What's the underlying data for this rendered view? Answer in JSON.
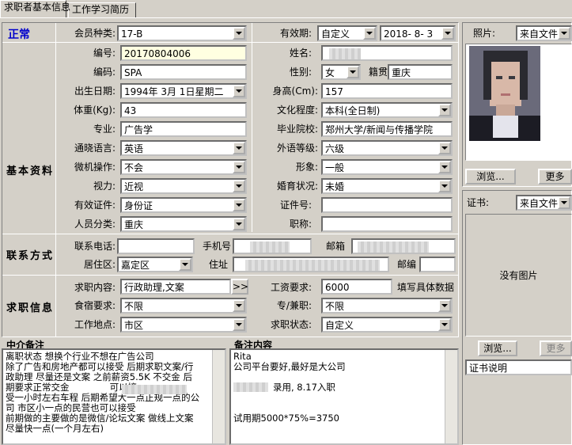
{
  "tabs": [
    {
      "label": "求职者基本信息"
    },
    {
      "label": "工作学习简历"
    }
  ],
  "status": "正常",
  "sections": {
    "basic": "基本资料",
    "contact": "联系方式",
    "job": "求职信息",
    "agent_note": "中介备注",
    "remark": "备注内容"
  },
  "labels": {
    "member_type": "会员种类:",
    "validity": "有效期:",
    "number": "编号:",
    "name": "姓名:",
    "code": "编码:",
    "gender": "性别:",
    "native": "籍贯",
    "birth": "出生日期:",
    "height": "身高(Cm):",
    "weight": "体重(Kg):",
    "education": "文化程度:",
    "major": "专业:",
    "school": "毕业院校:",
    "language": "通晓语言:",
    "foreign": "外语等级:",
    "computer": "微机操作:",
    "appearance": "形象:",
    "eyesight": "视力:",
    "marital": "婚育状况:",
    "id_type": "有效证件:",
    "id_no": "证件号:",
    "category": "人员分类:",
    "title": "职称:",
    "phone": "联系电话:",
    "mobile": "手机号",
    "email": "邮箱",
    "residence": "居住区:",
    "address": "住址",
    "postcode": "邮编",
    "job_content": "求职内容:",
    "salary": "工资要求:",
    "salary_note": "填写具体数据",
    "board": "食宿要求:",
    "fulltime": "专/兼职:",
    "location": "工作地点:",
    "job_status": "求职状态:",
    "photo": "照片:",
    "cert": "证书:"
  },
  "values": {
    "member_type": "17-B",
    "validity_type": "自定义",
    "validity_date": "2018- 8- 3",
    "number": "20170804006",
    "code": "SPA",
    "gender": "女",
    "native": "重庆",
    "birth": "1994年 3月 1日星期二",
    "height": "157",
    "weight": "43",
    "education": "本科(全日制)",
    "major": "广告学",
    "school": "郑州大学/新闻与传播学院",
    "language": "英语",
    "foreign": "六级",
    "computer": "不会",
    "appearance": "一般",
    "eyesight": "近视",
    "marital": "未婚",
    "id_type": "身份证",
    "category": "重庆",
    "residence": "嘉定区",
    "job_content": "行政助理,文案",
    "salary": "6000",
    "board": "不限",
    "fulltime": "不限",
    "location": "市区",
    "job_status": "自定义",
    "photo_source": "来自文件",
    "cert_source": "来自文件"
  },
  "buttons": {
    "browse": "浏览...",
    "more": "更多",
    "more_arrow": ">>",
    "browse2": "浏览...",
    "more2": "更多"
  },
  "no_image": "没有图片",
  "cert_desc": "证书说明",
  "agent_note_text": "离职状态 想换个行业不想在广告公司\n除了广告和房地产都可以接受 后期求职文案/行\n政助理 尽量还是文案 之前薪资5.5K 不交金 后\n期要求正常交金              可以接\n受一小时左右车程 后期希望大一点正规一点的公\n司 市区小一点的民营也可以接受\n前期做的主要做的是微信/论坛文案 做线上文案\n尽量快一点(一个月左右)",
  "remark_lines": {
    "l1": "Rita",
    "l2": "公司平台要好,最好是大公司",
    "l3": "录用, 8.17入职",
    "l4": "试用期5000*75%=3750"
  }
}
